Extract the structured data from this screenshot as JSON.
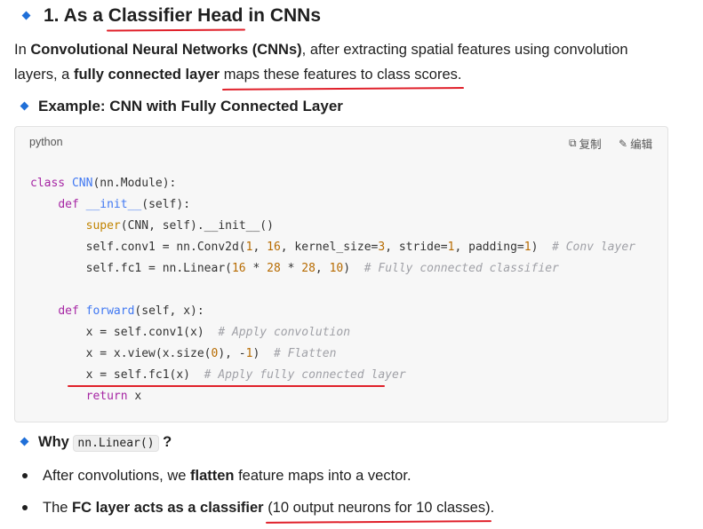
{
  "heading": {
    "part1": "1. As a ",
    "part2": "Classifier Head",
    "part3": " in CNNs"
  },
  "intro": {
    "t1": "In ",
    "b1": "Convolutional Neural Networks (CNNs)",
    "t2": ", after extracting spatial features using convolution",
    "t3": "layers, a ",
    "b2": "fully connected layer",
    "t4": " ",
    "u1": "maps these features to class scores."
  },
  "example_heading": "Example: CNN with Fully Connected Layer",
  "code_block": {
    "language": "python",
    "copy_label": "复制",
    "edit_label": "编辑"
  },
  "why": {
    "label": "Why ",
    "code": "nn.Linear()",
    "suffix": " ?"
  },
  "bullets": {
    "b1_t1": "After convolutions, we ",
    "b1_b": "flatten",
    "b1_t2": " feature maps into a vector.",
    "b2_t1": "The ",
    "b2_b": "FC layer acts as a classifier",
    "b2_t2": " ",
    "b2_u": "(10 output neurons for 10 classes)",
    "b2_t3": "."
  },
  "colors": {
    "accent": "#1f6fd8",
    "underline": "#e0202a",
    "keyword": "#a626a4",
    "function": "#4078f2",
    "number": "#b76b01",
    "comment": "#a0a1a7"
  }
}
